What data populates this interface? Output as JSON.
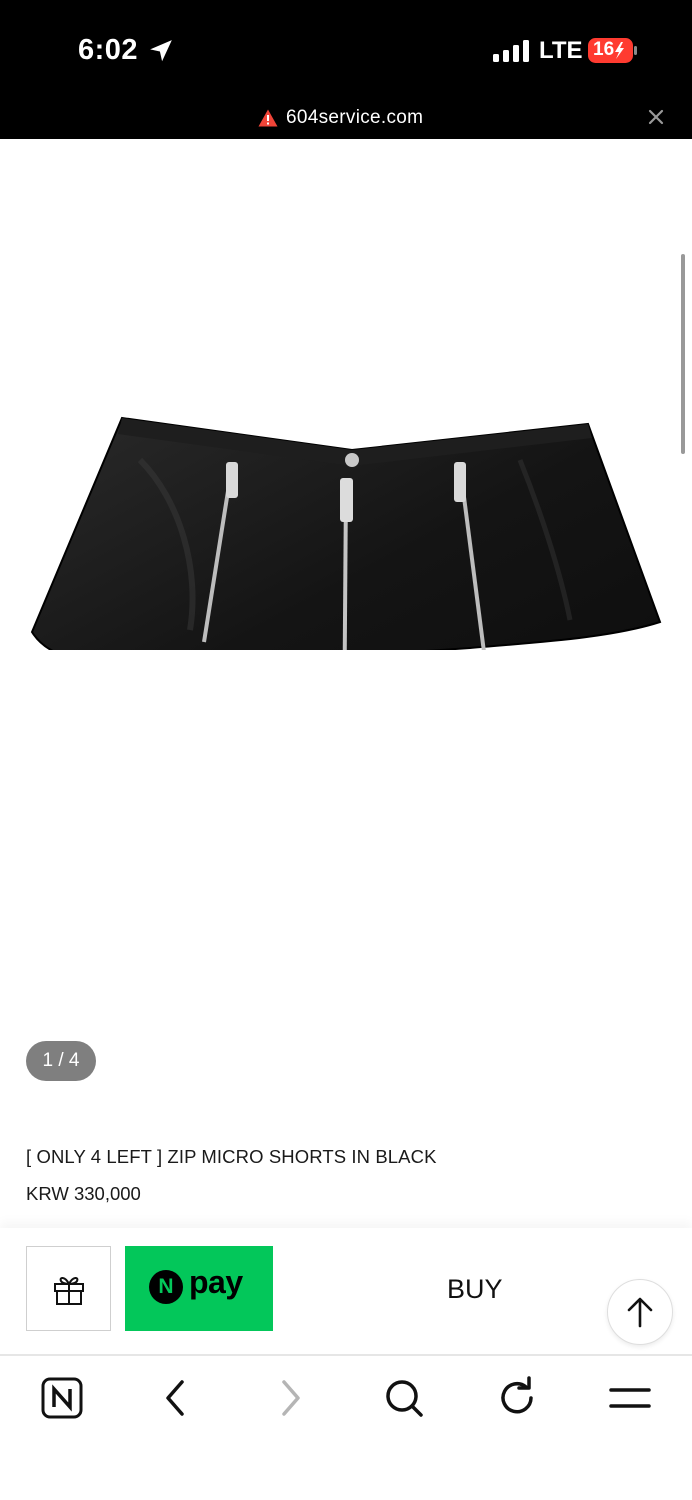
{
  "status_bar": {
    "time": "6:02",
    "network": "LTE",
    "battery": "16"
  },
  "url_bar": {
    "domain": "604service.com"
  },
  "gallery": {
    "page_indicator": "1 / 4"
  },
  "product": {
    "title": "[ ONLY 4 LEFT ] ZIP MICRO SHORTS IN BLACK",
    "price": "KRW 330,000"
  },
  "purchase_bar": {
    "npay_logo_letter": "N",
    "npay_label": "pay",
    "buy_label": "BUY"
  },
  "colors": {
    "npay_green": "#03c75a",
    "battery_red": "#ff3b30",
    "badge_gray": "#7f7f7f"
  },
  "icons": [
    "location-arrow-icon",
    "signal-bars-icon",
    "battery-icon",
    "warning-icon",
    "close-icon",
    "gift-icon",
    "arrow-up-icon",
    "naver-icon",
    "back-chevron-icon",
    "forward-chevron-icon",
    "search-icon",
    "refresh-icon",
    "menu-icon"
  ]
}
